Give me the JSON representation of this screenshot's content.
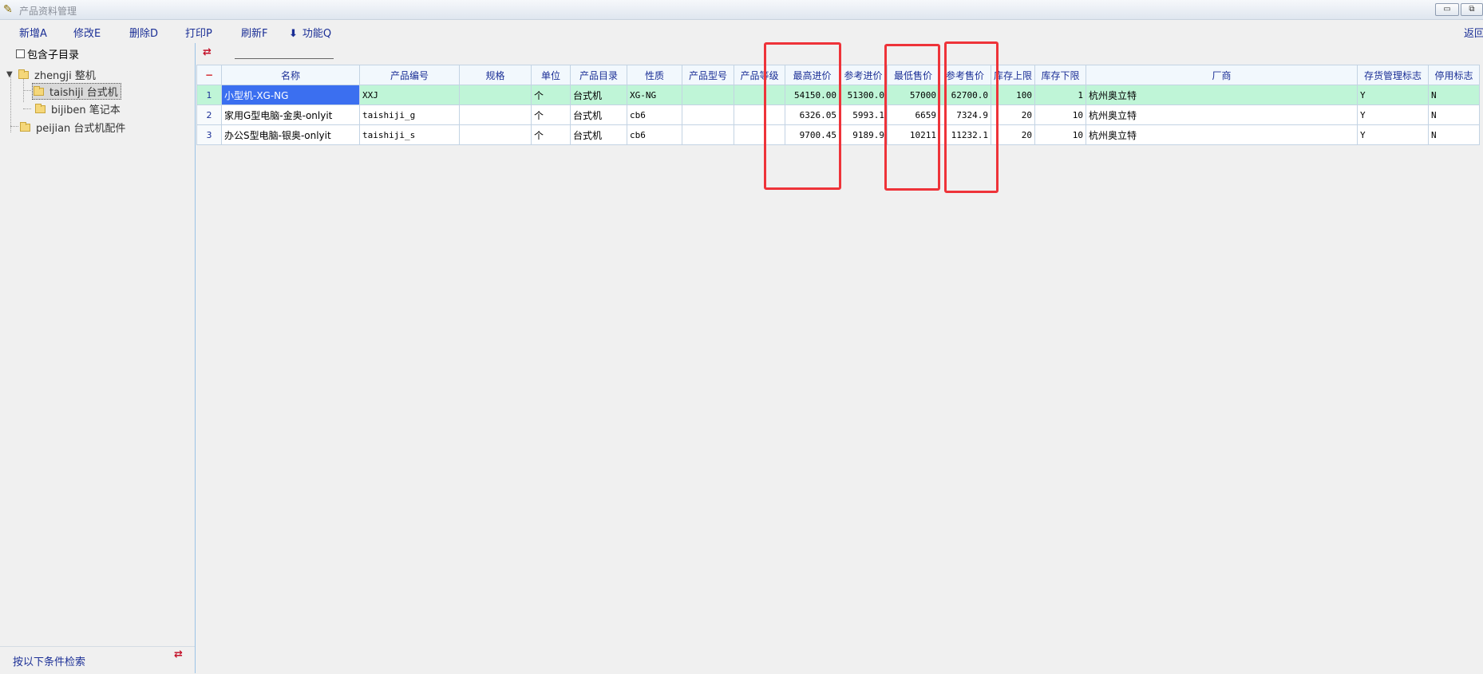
{
  "window": {
    "title": "产品资料管理",
    "minimize_glyph": "▭",
    "restore_glyph": "⧉"
  },
  "toolbar": {
    "add": "新增A",
    "edit": "修改E",
    "delete": "删除D",
    "print": "打印P",
    "refresh": "刷新F",
    "func": "功能Q",
    "back": "返回"
  },
  "tree": {
    "include_sub": "包含子目录",
    "nodes": [
      {
        "label": "zhengji 整机"
      },
      {
        "label": "taishiji 台式机"
      },
      {
        "label": "bijiben 笔记本"
      },
      {
        "label": "peijian 台式机配件"
      }
    ],
    "expander": "▼"
  },
  "search": {
    "label": "按以下条件检索"
  },
  "icons": {
    "swap": "⇄",
    "func_arrow": "⬇",
    "corner": "−"
  },
  "colors": {
    "accent": "#1b2f96",
    "selected_row": "#bff5d7",
    "selected_cell": "#3b6ff0",
    "highlight": "#ee3339"
  },
  "grid": {
    "columns": [
      "名称",
      "产品编号",
      "规格",
      "单位",
      "产品目录",
      "性质",
      "产品型号",
      "产品等级",
      "最高进价",
      "参考进价",
      "最低售价",
      "参考售价",
      "库存上限",
      "库存下限",
      "厂商",
      "存货管理标志",
      "停用标志"
    ],
    "rows": [
      {
        "num": "1",
        "name": "小型机-XG-NG",
        "code": "XXJ",
        "spec": "",
        "unit": "个",
        "catalog": "台式机",
        "nature": "XG-NG",
        "model": "",
        "grade": "",
        "max_in": "54150.00",
        "ref_in": "51300.0",
        "min_sale": "57000",
        "ref_sale": "62700.0",
        "stock_max": "100",
        "stock_min": "1",
        "vendor": "杭州奥立特",
        "inv_flag": "Y",
        "stop_flag": "N"
      },
      {
        "num": "2",
        "name": "家用G型电脑-金奥-onlyit",
        "code": "taishiji_g",
        "spec": "",
        "unit": "个",
        "catalog": "台式机",
        "nature": "cb6",
        "model": "",
        "grade": "",
        "max_in": "6326.05",
        "ref_in": "5993.1",
        "min_sale": "6659",
        "ref_sale": "7324.9",
        "stock_max": "20",
        "stock_min": "10",
        "vendor": "杭州奥立特",
        "inv_flag": "Y",
        "stop_flag": "N"
      },
      {
        "num": "3",
        "name": "办公S型电脑-银奥-onlyit",
        "code": "taishiji_s",
        "spec": "",
        "unit": "个",
        "catalog": "台式机",
        "nature": "cb6",
        "model": "",
        "grade": "",
        "max_in": "9700.45",
        "ref_in": "9189.9",
        "min_sale": "10211",
        "ref_sale": "11232.1",
        "stock_max": "20",
        "stock_min": "10",
        "vendor": "杭州奥立特",
        "inv_flag": "Y",
        "stop_flag": "N"
      }
    ]
  }
}
